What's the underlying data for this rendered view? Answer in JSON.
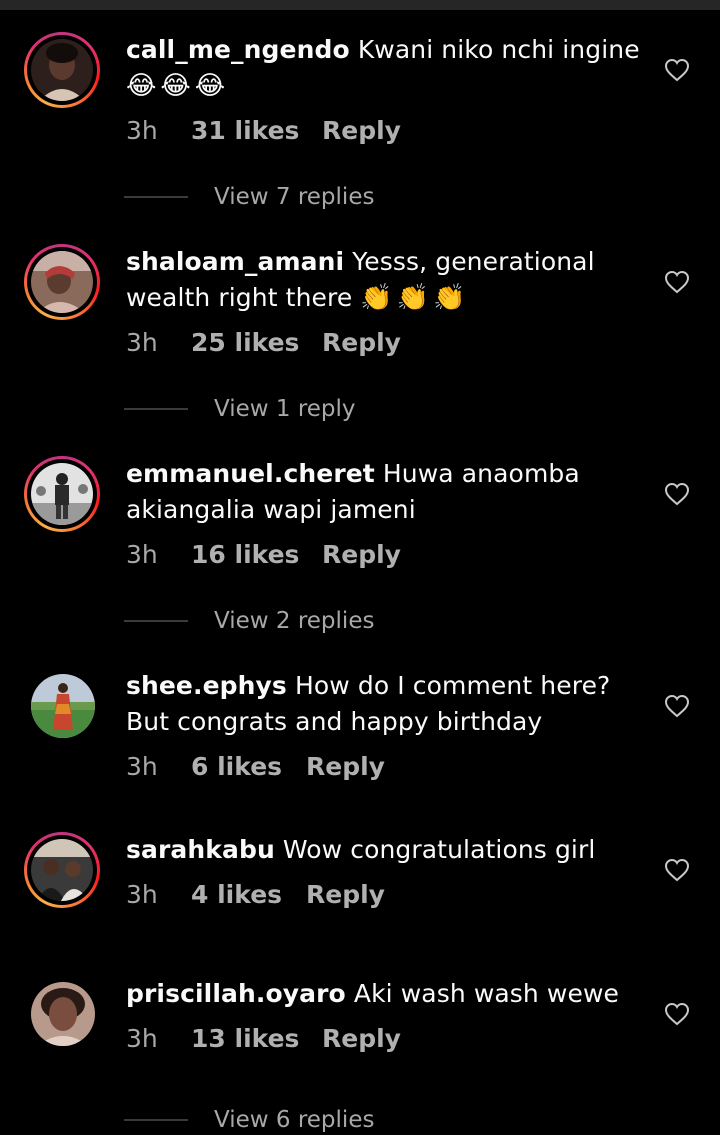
{
  "comments": [
    {
      "username": "call_me_ngendo",
      "text": "Kwani niko nchi ingine",
      "emoji": "😂😂😂",
      "time": "3h",
      "likes": "31 likes",
      "reply": "Reply",
      "view_replies": "View 7 replies",
      "story_ring": true,
      "avatar_palette": [
        "#3b2a26",
        "#d9c2b0",
        "#1a1210"
      ]
    },
    {
      "username": "shaloam_amani",
      "text": "Yesss, generational wealth right there",
      "emoji": "👏👏👏",
      "time": "3h",
      "likes": "25 likes",
      "reply": "Reply",
      "view_replies": "View 1 reply",
      "story_ring": true,
      "avatar_palette": [
        "#6d4a3a",
        "#b9504d",
        "#e3c7b8"
      ]
    },
    {
      "username": "emmanuel.cheret",
      "text": "Huwa anaomba akiangalia wapi jameni",
      "emoji": "",
      "time": "3h",
      "likes": "16 likes",
      "reply": "Reply",
      "view_replies": "View 2 replies",
      "story_ring": true,
      "avatar_palette": [
        "#d8d8d8",
        "#8a8a8a",
        "#2b2b2b"
      ]
    },
    {
      "username": "shee.ephys",
      "text": "How do I comment here? But congrats and happy birthday",
      "emoji": "",
      "time": "3h",
      "likes": "6 likes",
      "reply": "Reply",
      "view_replies": "",
      "story_ring": false,
      "avatar_palette": [
        "#b8c4d6",
        "#3f7a3a",
        "#c9452e"
      ]
    },
    {
      "username": "sarahkabu",
      "text": "Wow congratulations girl",
      "emoji": "",
      "time": "3h",
      "likes": "4 likes",
      "reply": "Reply",
      "view_replies": "",
      "story_ring": true,
      "avatar_palette": [
        "#4a4a4a",
        "#c9c2b8",
        "#1e1e1e"
      ]
    },
    {
      "username": "priscillah.oyaro",
      "text": "Aki wash wash wewe",
      "emoji": "",
      "time": "3h",
      "likes": "13 likes",
      "reply": "Reply",
      "view_replies": "View 6 replies",
      "story_ring": false,
      "avatar_palette": [
        "#7a5a4e",
        "#e9d2c6",
        "#2a1a16"
      ]
    }
  ]
}
